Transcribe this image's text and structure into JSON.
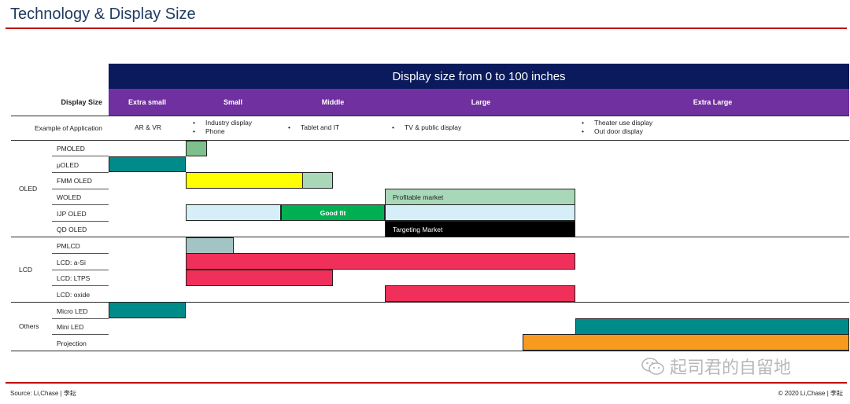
{
  "title": "Technology & Display Size",
  "banner": "Display size from 0 to 100 inches",
  "size_header": {
    "row_label": "Display Size",
    "columns": [
      "Extra small",
      "Small",
      "Middle",
      "Large",
      "Extra Large"
    ]
  },
  "applications": {
    "row_label": "Example of Application",
    "extra_small": "AR & VR",
    "small": [
      "Industry display",
      "Phone"
    ],
    "middle": [
      "Tablet and IT"
    ],
    "large": [
      "TV & public display"
    ],
    "extra_large": [
      "Theater use display",
      "Out door display"
    ]
  },
  "groups": [
    "OLED",
    "LCD",
    "Others"
  ],
  "technologies": [
    "PMOLED",
    "μOLED",
    "FMM OLED",
    "WOLED",
    "IJP OLED",
    "QD OLED",
    "PMLCD",
    "LCD: a-Si",
    "LCD: LTPS",
    "LCD: oxide",
    "Micro LED",
    "Mini LED",
    "Projection"
  ],
  "bar_labels": {
    "profitable": "Profitable market",
    "good_fit": "Good fit",
    "targeting": "Targeting Market"
  },
  "colors": {
    "banner": "#0a1a5c",
    "size_header": "#7030a0",
    "rule": "#c00000",
    "teal": "#008b8b",
    "light_green": "#a9d8b8",
    "yellow": "#ffff00",
    "light_blue": "#d6eef8",
    "green": "#00b050",
    "black": "#000000",
    "grey_teal": "#a3c4c4",
    "crimson": "#f0305a",
    "orange": "#f79a1e"
  },
  "footer": {
    "source": "Source: Li,Chase | 李耘",
    "copyright": "© 2020 Li,Chase | 李耘"
  },
  "watermark": "起司君的自留地"
}
